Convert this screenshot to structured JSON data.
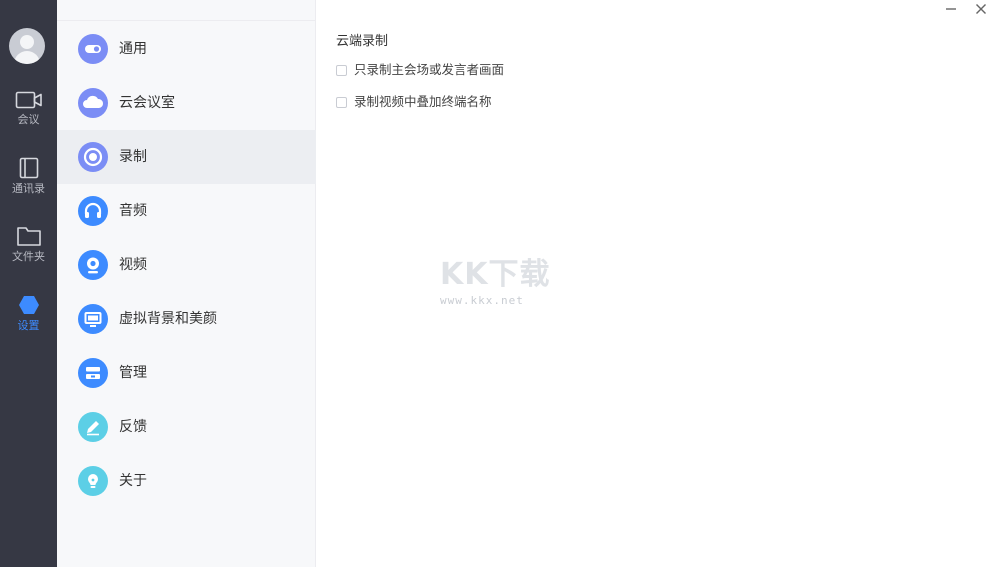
{
  "nav": {
    "items": [
      {
        "label": "会议",
        "icon": "video-camera-icon"
      },
      {
        "label": "通讯录",
        "icon": "contacts-book-icon"
      },
      {
        "label": "文件夹",
        "icon": "folder-icon"
      },
      {
        "label": "设置",
        "icon": "settings-hexagon-icon",
        "active": true
      }
    ]
  },
  "settings": {
    "items": [
      {
        "label": "通用",
        "icon": "toggle-icon",
        "color": "#7b8df5"
      },
      {
        "label": "云会议室",
        "icon": "cloud-icon",
        "color": "#7b8df5"
      },
      {
        "label": "录制",
        "icon": "record-icon",
        "color": "#7b8df5",
        "active": true
      },
      {
        "label": "音频",
        "icon": "headphones-icon",
        "color": "#3d8bff"
      },
      {
        "label": "视频",
        "icon": "webcam-icon",
        "color": "#3d8bff"
      },
      {
        "label": "虚拟背景和美颜",
        "icon": "monitor-icon",
        "color": "#3d8bff"
      },
      {
        "label": "管理",
        "icon": "manage-icon",
        "color": "#3d8bff"
      },
      {
        "label": "反馈",
        "icon": "pencil-icon",
        "color": "#5ccfe6"
      },
      {
        "label": "关于",
        "icon": "lightbulb-icon",
        "color": "#5ccfe6"
      }
    ]
  },
  "main": {
    "section_title": "云端录制",
    "options": [
      {
        "label": "只录制主会场或发言者画面",
        "checked": false
      },
      {
        "label": "录制视频中叠加终端名称",
        "checked": false
      }
    ]
  },
  "watermark": {
    "big": "KK下载",
    "small": "www.kkx.net"
  },
  "colors": {
    "nav_bg": "#363844",
    "accent": "#3d8bff",
    "list_bg": "#f7f8fa",
    "active_row": "#eceef2"
  }
}
